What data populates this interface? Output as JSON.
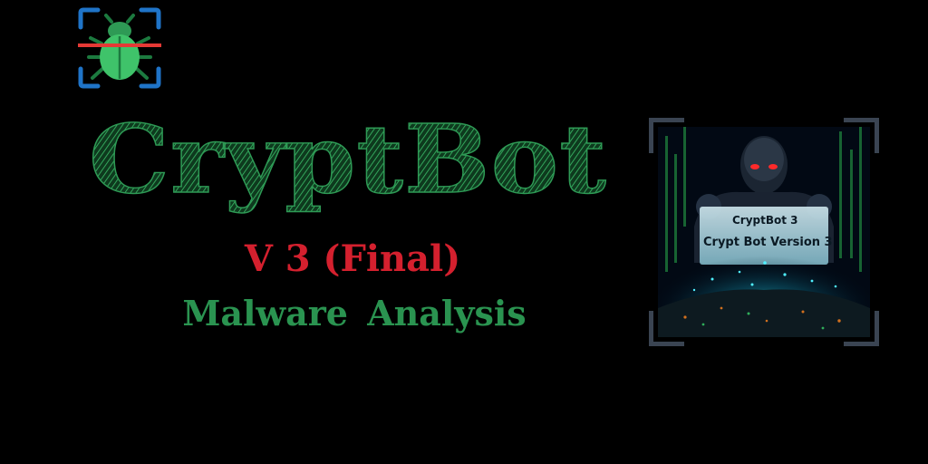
{
  "title": "CryptBot",
  "version_label": "V 3 (Final)",
  "subtitle": "Malware Analysis",
  "artwork": {
    "line1": "CryptBot 3",
    "line2": "Crypt Bot Version 3"
  },
  "icons": {
    "logo": "bug-scan-icon"
  },
  "colors": {
    "background": "#000000",
    "title_green": "#2e9a55",
    "version_red": "#d4202e",
    "subtitle_green": "#2a9350",
    "bug_green": "#3fc36a",
    "scan_line": "#e53935",
    "bracket_blue": "#1f74c8"
  }
}
